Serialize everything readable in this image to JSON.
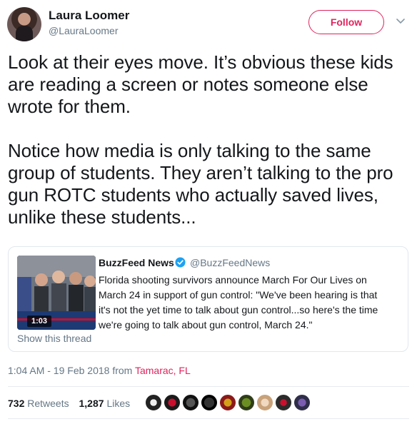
{
  "author": {
    "name": "Laura Loomer",
    "handle": "@LauraLoomer",
    "avatar_icon": "profile-photo",
    "follow_label": "Follow"
  },
  "tweet": {
    "text": "Look at their eyes move. It’s obvious these kids are reading a screen or notes someone else wrote for them.\n\nNotice how media is only talking to the same group of students. They aren’t talking to the pro gun ROTC students who actually saved lives, unlike these students..."
  },
  "quoted": {
    "name": "BuzzFeed News",
    "verified_icon": "verified-badge",
    "handle": "@BuzzFeedNews",
    "text": "Florida shooting survivors announce March For Our Lives on March 24 in support of gun control: \"We've been hearing is that it's not the yet time to talk about gun control...so here's the time we're going to talk about gun control, March 24.\"",
    "duration": "1:03",
    "show_thread": "Show this thread"
  },
  "meta": {
    "timestamp": "1:04 AM - 19 Feb 2018 from ",
    "location": "Tamarac, FL"
  },
  "stats": {
    "retweets_count": "732",
    "retweets_label": "Retweets",
    "likes_count": "1,287",
    "likes_label": "Likes"
  },
  "colors": {
    "accent": "#e0245e",
    "verified": "#1da1f2",
    "muted": "#657786"
  }
}
